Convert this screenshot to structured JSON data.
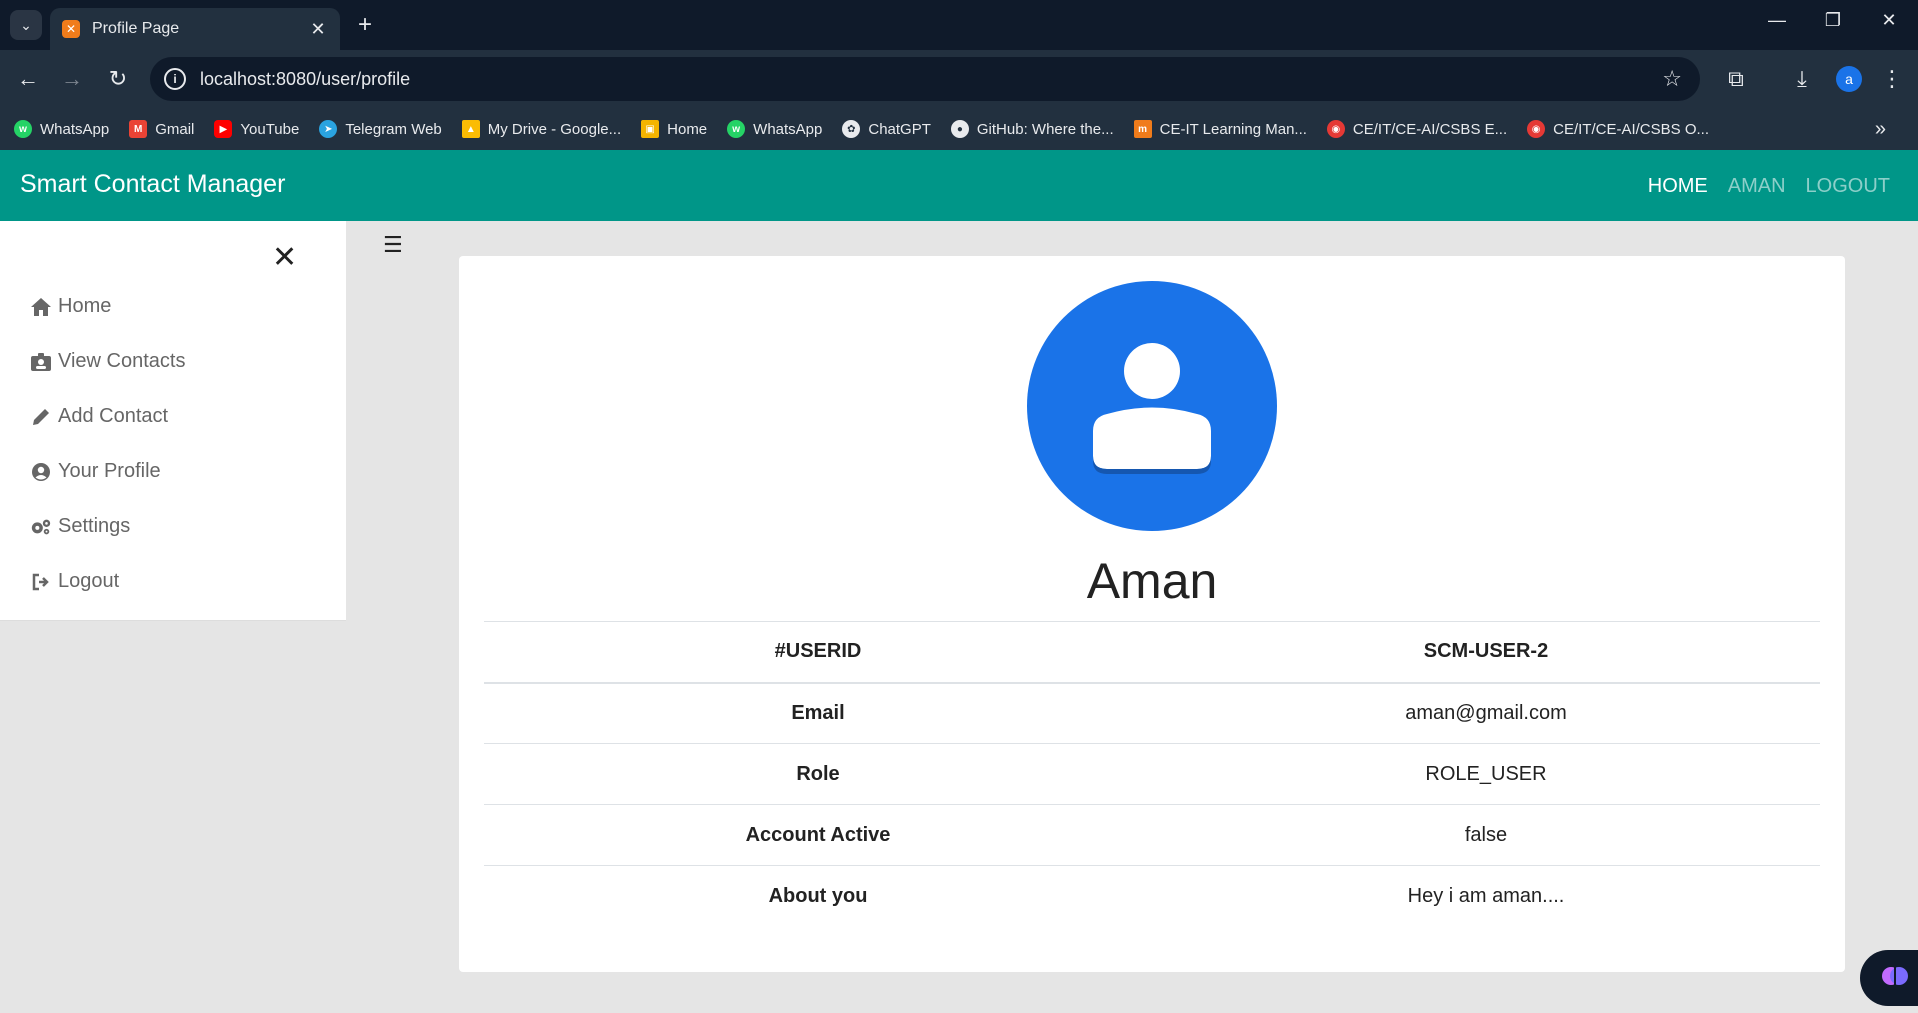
{
  "browser": {
    "tab_title": "Profile Page",
    "url": "localhost:8080/user/profile",
    "profile_initial": "a",
    "bookmarks": [
      {
        "label": "WhatsApp",
        "color": "#25d366"
      },
      {
        "label": "Gmail",
        "color": "#ea4335"
      },
      {
        "label": "YouTube",
        "color": "#ff0000"
      },
      {
        "label": "Telegram Web",
        "color": "#2aa3e0"
      },
      {
        "label": "My Drive - Google...",
        "color": "#fbbc04"
      },
      {
        "label": "Home",
        "color": "#f4b400"
      },
      {
        "label": "WhatsApp",
        "color": "#25d366"
      },
      {
        "label": "ChatGPT",
        "color": "#e8eaed"
      },
      {
        "label": "GitHub: Where the...",
        "color": "#e8eaed"
      },
      {
        "label": "CE-IT Learning Man...",
        "color": "#f07c1b"
      },
      {
        "label": "CE/IT/CE-AI/CSBS E...",
        "color": "#e53935"
      },
      {
        "label": "CE/IT/CE-AI/CSBS O...",
        "color": "#e53935"
      }
    ]
  },
  "app": {
    "brand": "Smart Contact Manager",
    "nav": {
      "home": "HOME",
      "user": "AMAN",
      "logout": "LOGOUT"
    },
    "accent": "#009688"
  },
  "sidebar": {
    "items": [
      {
        "label": "Home",
        "icon": "home-icon"
      },
      {
        "label": "View Contacts",
        "icon": "contacts-icon"
      },
      {
        "label": "Add Contact",
        "icon": "pencil-icon"
      },
      {
        "label": "Your Profile",
        "icon": "user-circle-icon"
      },
      {
        "label": "Settings",
        "icon": "gears-icon"
      },
      {
        "label": "Logout",
        "icon": "sign-out-icon"
      }
    ]
  },
  "profile": {
    "name": "Aman",
    "rows": [
      {
        "key": "#USERID",
        "value": "SCM-USER-2"
      },
      {
        "key": "Email",
        "value": "aman@gmail.com"
      },
      {
        "key": "Role",
        "value": "ROLE_USER"
      },
      {
        "key": "Account Active",
        "value": "false"
      },
      {
        "key": "About you",
        "value": "Hey i am aman...."
      }
    ]
  }
}
